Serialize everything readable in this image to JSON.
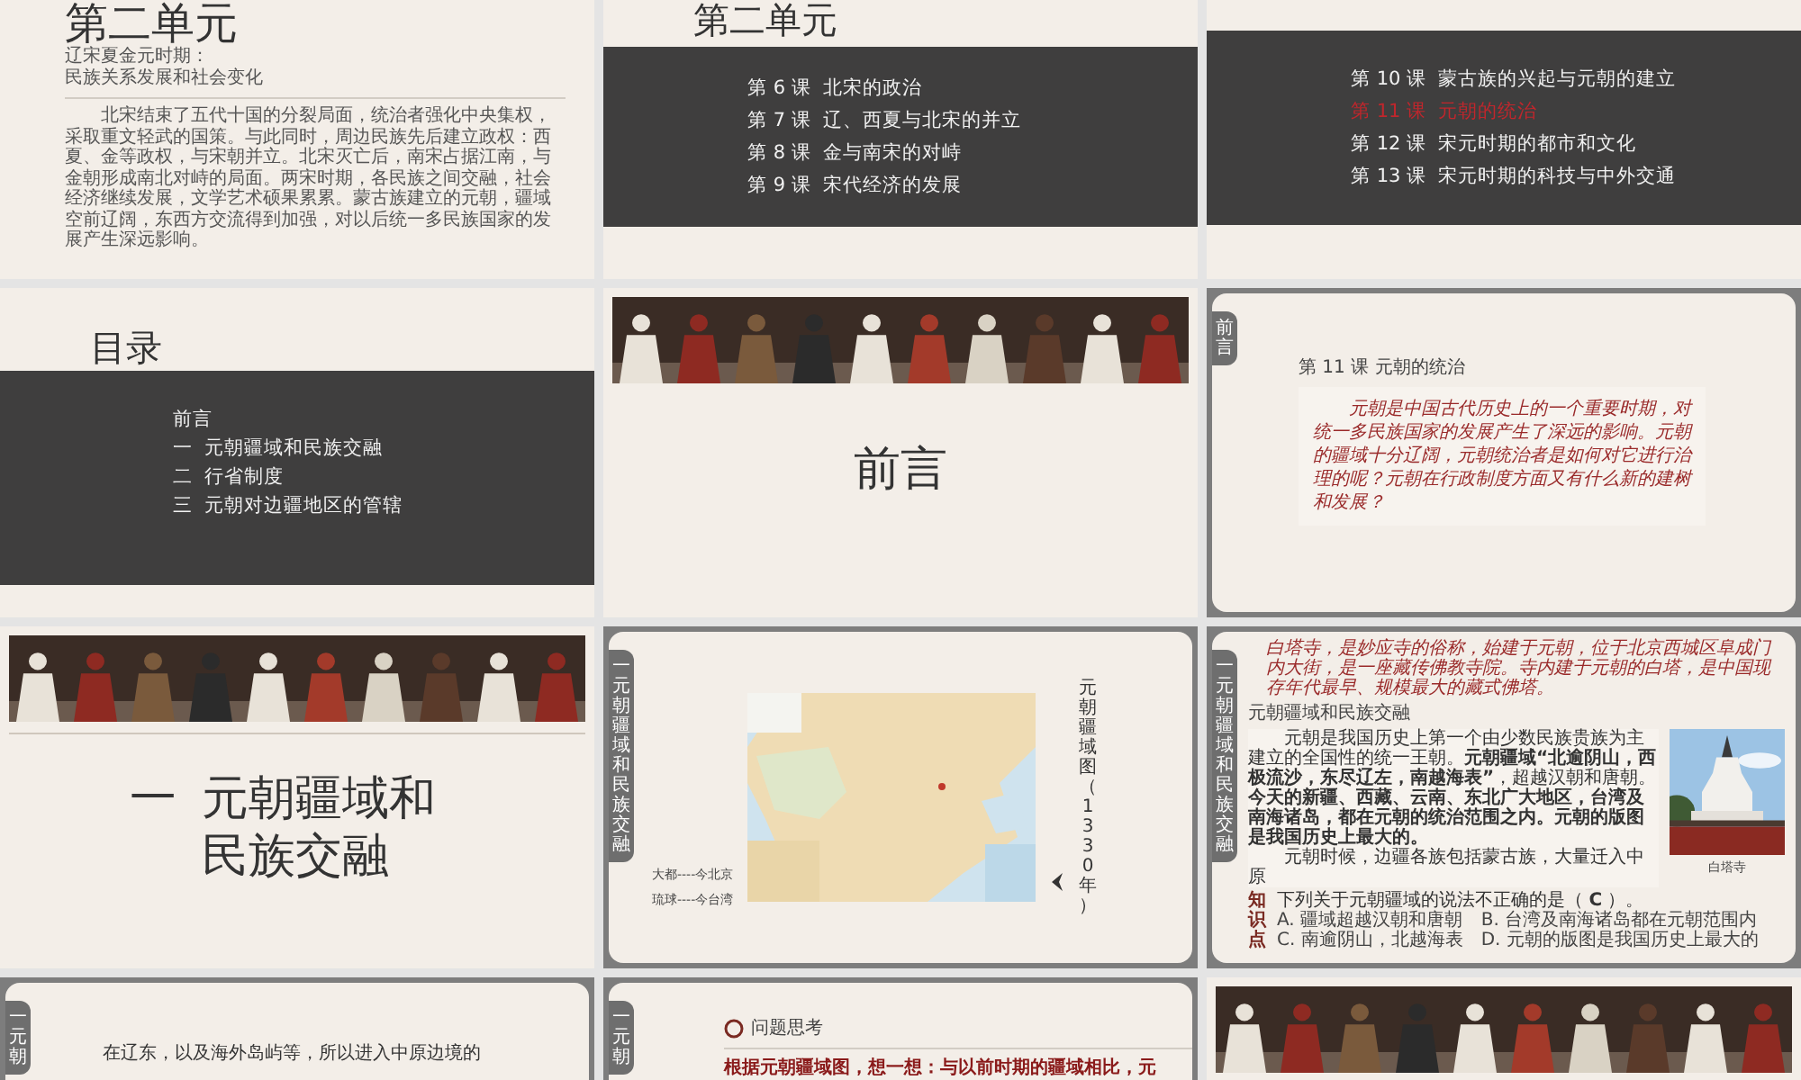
{
  "slides": [
    {
      "kind": "unit-intro",
      "title": "第二单元",
      "subtitle": [
        "辽宋夏金元时期：",
        "民族关系发展和社会变化"
      ],
      "body": "北宋结束了五代十国的分裂局面，统治者强化中央集权，采取重文轻武的国策。与此同时，周边民族先后建立政权：西夏、金等政权，与宋朝并立。北宋灭亡后，南宋占据江南，与金朝形成南北对峙的局面。两宋时期，各民族之间交融，社会经济继续发展，文学艺术硕果累累。蒙古族建立的元朝，疆域空前辽阔，东西方交流得到加强，对以后统一多民族国家的发展产生深远影响。"
    },
    {
      "kind": "lesson-list",
      "title": "第二单元",
      "lessons": [
        {
          "label": "第 6 课  北宋的政治",
          "current": false
        },
        {
          "label": "第 7 课  辽、西夏与北宋的并立",
          "current": false
        },
        {
          "label": "第 8 课  金与南宋的对峙",
          "current": false
        },
        {
          "label": "第 9 课  宋代经济的发展",
          "current": false
        }
      ]
    },
    {
      "kind": "lesson-list",
      "lessons": [
        {
          "label": "第 10 课  蒙古族的兴起与元朝的建立",
          "current": false
        },
        {
          "label": "第 11 课  元朝的统治",
          "current": true
        },
        {
          "label": "第 12 课  宋元时期的都市和文化",
          "current": false
        },
        {
          "label": "第 13 课  宋元时期的科技与中外交通",
          "current": false
        }
      ]
    },
    {
      "kind": "toc",
      "title": "目录",
      "items": [
        "前言",
        "一  元朝疆域和民族交融",
        "二  行省制度",
        "三  元朝对边疆地区的管辖"
      ]
    },
    {
      "kind": "section",
      "title": "前言"
    },
    {
      "kind": "lesson-intro",
      "tab": "前言",
      "title": "第 11 课 元朝的统治",
      "body": "元朝是中国古代历史上的一个重要时期，对统一多民族国家的发展产生了深远的影响。元朝的疆域十分辽阔，元朝统治者是如何对它进行治理的呢？元朝在行政制度方面又有什么新的建树和发展？"
    },
    {
      "kind": "section",
      "marker": "一",
      "title": "元朝疆域和民族交融"
    },
    {
      "kind": "map",
      "tab": "一元朝疆域和民族交融",
      "legend": [
        "大都----今北京",
        "琉球----今台湾"
      ],
      "caption": "元朝疆域图（1330 年）"
    },
    {
      "kind": "content",
      "tab": "一元朝疆域和民族交融",
      "note": "白塔寺，是妙应寺的俗称，始建于元朝，位于北京西城区阜成门内大街，是一座藏传佛教寺院。寺内建于元朝的白塔，是中国现存年代最早、规模最大的藏式佛塔。",
      "title": "元朝疆域和民族交融",
      "paragraphs": [
        "元朝是我国历史上第一个由少数民族贵族为主建立的全国性的统一王朝。**元朝疆域“北逾阴山，西极流沙，东尽辽左，南越海表”**，超越汉朝和唐朝。**今天的新疆、西藏、云南、东北广大地区，台湾及南海诸岛，都在元朝的统治范围之内。元朝的版图是我国历史上最大的。**",
        "元朝时候，边疆各族包括蒙古族，大量迁入中原"
      ],
      "photo_caption": "白塔寺",
      "quiz": {
        "label": "知识点",
        "question": "下列关于元朝疆域的说法不正确的是（ **C** ）。",
        "options": [
          "A. 疆域超越汉朝和唐朝",
          "B. 台湾及南海诸岛都在元朝范围内",
          "C. 南逾阴山，北越海表",
          "D. 元朝的版图是我国历史上最大的"
        ]
      }
    },
    {
      "kind": "text",
      "tab": "一元朝",
      "body": "在辽东，以及海外岛屿等，所以进入中原边境的"
    },
    {
      "kind": "question",
      "tab": "一元朝",
      "heading": "问题思考",
      "body": "根据元朝疆域图，想一想：与以前时期的疆域相比，元"
    },
    {
      "kind": "banner"
    }
  ]
}
